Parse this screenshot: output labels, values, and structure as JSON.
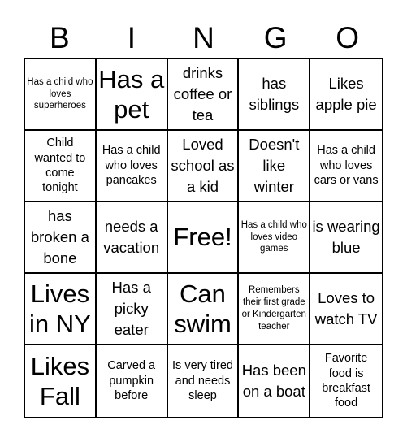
{
  "header": {
    "letters": [
      "B",
      "I",
      "N",
      "G",
      "O"
    ]
  },
  "cells": [
    {
      "text": "Has a child who loves superheroes",
      "size": "s-xs"
    },
    {
      "text": "Has a pet",
      "size": "s-xl"
    },
    {
      "text": "drinks coffee or tea",
      "size": "s-md"
    },
    {
      "text": "has siblings",
      "size": "s-md"
    },
    {
      "text": "Likes apple pie",
      "size": "s-md"
    },
    {
      "text": "Child wanted to come tonight",
      "size": "s-sm"
    },
    {
      "text": "Has a child who loves pancakes",
      "size": "s-sm"
    },
    {
      "text": "Loved school as a kid",
      "size": "s-md"
    },
    {
      "text": "Doesn't like winter",
      "size": "s-md"
    },
    {
      "text": "Has a child who loves cars or vans",
      "size": "s-sm"
    },
    {
      "text": "has broken a bone",
      "size": "s-md"
    },
    {
      "text": "needs a vacation",
      "size": "s-md"
    },
    {
      "text": "Free!",
      "size": "s-xl"
    },
    {
      "text": "Has a child who loves video games",
      "size": "s-xs"
    },
    {
      "text": "is wearing blue",
      "size": "s-md"
    },
    {
      "text": "Lives in NY",
      "size": "s-xl"
    },
    {
      "text": "Has a picky eater",
      "size": "s-md"
    },
    {
      "text": "Can swim",
      "size": "s-xl"
    },
    {
      "text": "Remembers their first grade or Kindergarten teacher",
      "size": "s-xs"
    },
    {
      "text": "Loves to watch TV",
      "size": "s-md"
    },
    {
      "text": "Likes Fall",
      "size": "s-xl"
    },
    {
      "text": "Carved a pumpkin before",
      "size": "s-sm"
    },
    {
      "text": "Is very tired and needs sleep",
      "size": "s-sm"
    },
    {
      "text": "Has been on a boat",
      "size": "s-md"
    },
    {
      "text": "Favorite food is breakfast food",
      "size": "s-sm"
    }
  ]
}
